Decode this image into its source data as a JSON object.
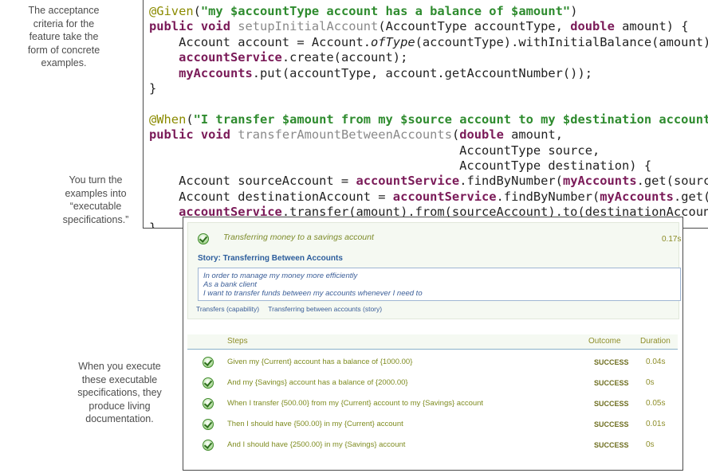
{
  "annotations": [
    {
      "lines": [
        "The acceptance",
        "criteria for the",
        "feature take the",
        "form of concrete",
        "examples."
      ]
    },
    {
      "lines": [
        "You turn the",
        "examples into",
        "“executable",
        "specifications.”"
      ]
    },
    {
      "lines": [
        "When you execute",
        "these executable",
        "specifications, they",
        "produce living",
        "documentation."
      ]
    }
  ],
  "code": {
    "line1": {
      "annotation": "@Given",
      "open": "(",
      "string": "\"my $accountType account has a balance of $amount\"",
      "close": ")"
    },
    "line2": {
      "kw1": "public",
      "kw2": "void",
      "method": "setupInitialAccount",
      "p1": "(AccountType accountType, ",
      "kw3": "double",
      "p2": " amount) {"
    },
    "line3": {
      "indent": "    ",
      "text1": "Account account = Account.",
      "italic": "ofType",
      "text2": "(accountType).withInitialBalance(amount);"
    },
    "line4": {
      "indent": "    ",
      "field": "accountService",
      "text": ".create(account);"
    },
    "line5": {
      "indent": "    ",
      "field": "myAccounts",
      "text": ".put(accountType, account.getAccountNumber());"
    },
    "line6": {
      "text": "}"
    },
    "line8": {
      "annotation": "@When",
      "open": "(",
      "string": "\"I transfer $amount from my $source account to my $destination account\"",
      "close": ")"
    },
    "line9": {
      "kw1": "public",
      "kw2": "void",
      "method": "transferAmountBetweenAccounts",
      "p1": "(",
      "kw3": "double",
      "p2": " amount,"
    },
    "line10": {
      "text": "                                          AccountType source,"
    },
    "line11": {
      "text": "                                          AccountType destination) {"
    },
    "line12": {
      "indent": "    ",
      "text1": "Account sourceAccount = ",
      "field1": "accountService",
      "text2": ".findByNumber(",
      "field2": "myAccounts",
      "text3": ".get(source)).g"
    },
    "line13": {
      "indent": "    ",
      "text1": "Account destinationAccount = ",
      "field1": "accountService",
      "text2": ".findByNumber(",
      "field2": "myAccounts",
      "text3": ".get(desti"
    },
    "line14": {
      "indent": "    ",
      "field": "accountService",
      "text": ".transfer(amount).from(sourceAccount).to(destinationAccount);"
    },
    "line15": {
      "text": "}"
    }
  },
  "report": {
    "scenario": {
      "title": "Transferring money to a savings account",
      "time": "0.17s",
      "icon": "success-check-icon"
    },
    "story_title": "Story: Transferring Between Accounts",
    "narrative": [
      "In order to manage my money more efficiently",
      "As a bank client",
      "I want to transfer funds between my accounts whenever I need to"
    ],
    "tags": [
      "Transfers (capability)",
      "Transferring between accounts (story)"
    ],
    "columns": {
      "steps": "Steps",
      "outcome": "Outcome",
      "duration": "Duration"
    },
    "steps": [
      {
        "text": "Given my {Current} account has a balance of {1000.00}",
        "outcome": "SUCCESS",
        "duration": "0.04s"
      },
      {
        "text": "And my {Savings} account has a balance of {2000.00}",
        "outcome": "SUCCESS",
        "duration": "0s"
      },
      {
        "text": "When I transfer {500.00} from my {Current} account to my {Savings} account",
        "outcome": "SUCCESS",
        "duration": "0.05s"
      },
      {
        "text": "Then I should have {500.00} in my {Current} account",
        "outcome": "SUCCESS",
        "duration": "0.01s"
      },
      {
        "text": "And I should have {2500.00} in my {Savings} account",
        "outcome": "SUCCESS",
        "duration": "0s"
      }
    ],
    "colors": {
      "success": "#4a9a30",
      "story_blue": "#2c5d9c",
      "step_text": "#7e8b1f"
    }
  }
}
